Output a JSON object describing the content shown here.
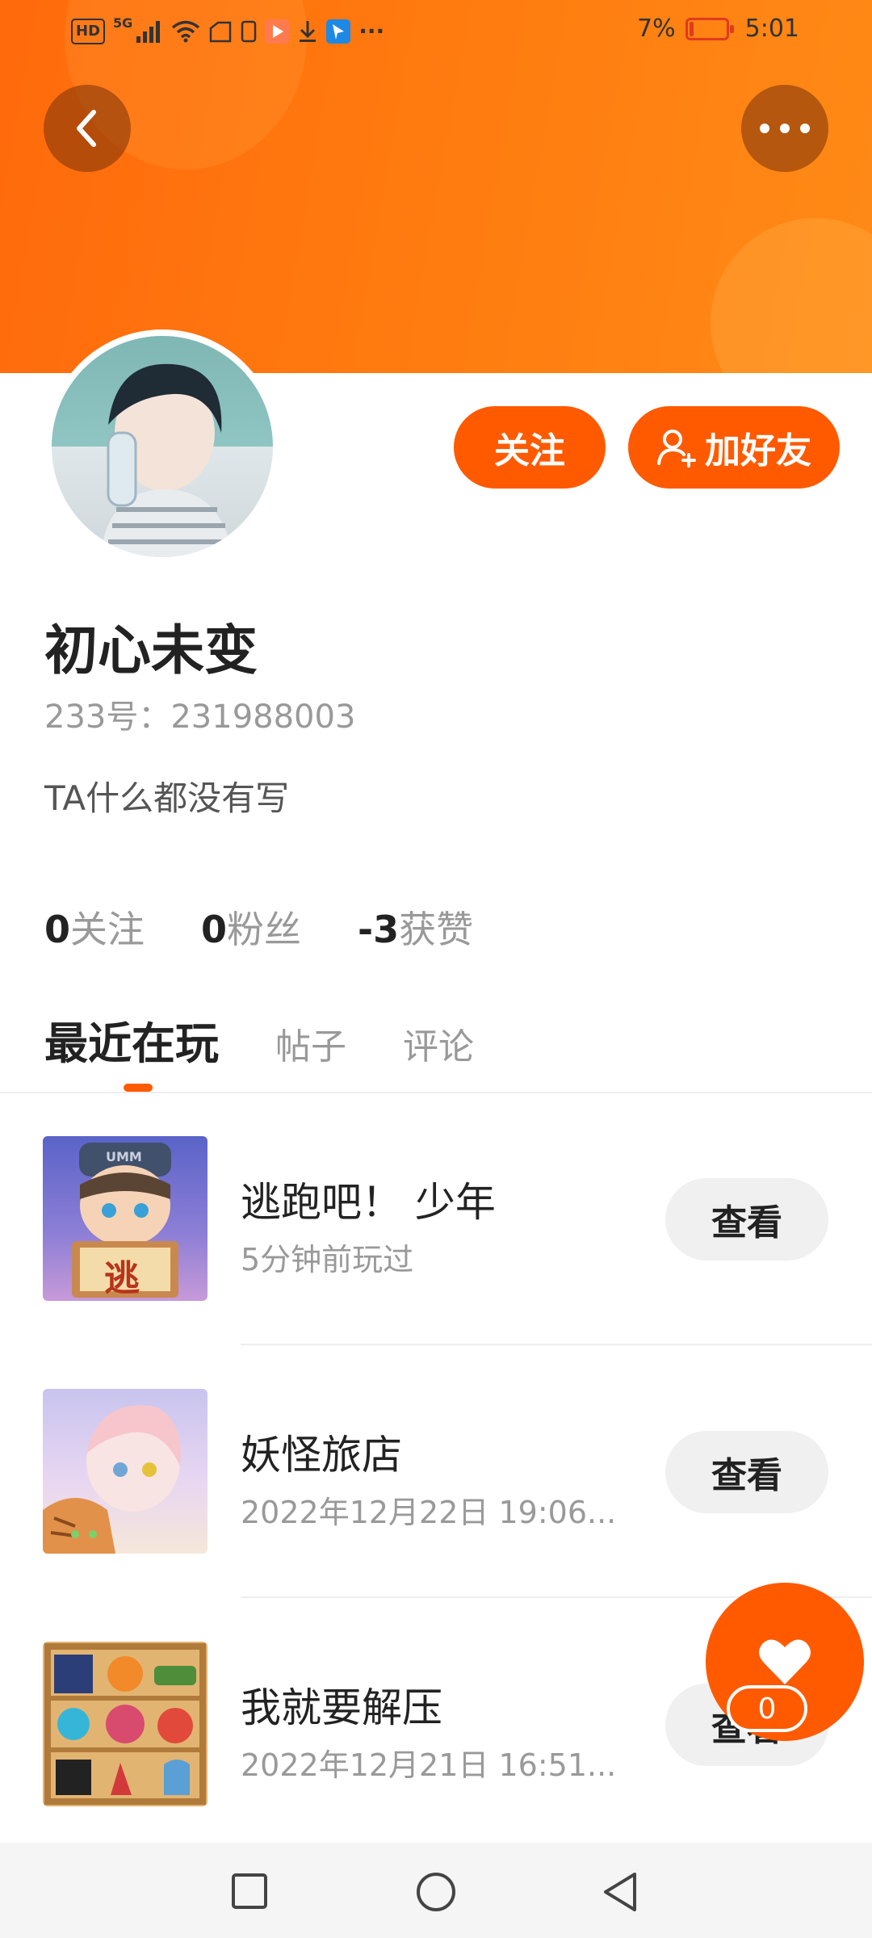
{
  "status_bar": {
    "hd": "HD",
    "network": "5G",
    "battery_percent": "7%",
    "time": "5:01",
    "more": "···"
  },
  "header": {
    "back_icon": "chevron-left-icon",
    "more_icon": "more-dots-icon"
  },
  "profile": {
    "follow_label": "关注",
    "add_friend_label": "加好友",
    "name": "初心未变",
    "uid": "233号：231988003",
    "bio": "TA什么都没有写"
  },
  "stats": {
    "following_count": "0",
    "following_label": "关注",
    "fans_count": "0",
    "fans_label": "粉丝",
    "likes_count": "-3",
    "likes_label": "获赞"
  },
  "tabs": [
    {
      "label": "最近在玩",
      "active": true
    },
    {
      "label": "帖子",
      "active": false
    },
    {
      "label": "评论",
      "active": false
    }
  ],
  "games": [
    {
      "title": "逃跑吧！ 少年",
      "subtitle": "5分钟前玩过",
      "button": "查看",
      "thumb_text": "逃",
      "cap_text": "UMM"
    },
    {
      "title": "妖怪旅店",
      "subtitle": "2022年12月22日 19:06...",
      "button": "查看"
    },
    {
      "title": "我就要解压",
      "subtitle": "2022年12月21日 16:51...",
      "button": "查看"
    }
  ],
  "fab": {
    "icon": "heart-icon",
    "count": "0"
  },
  "colors": {
    "accent": "#ff5a00",
    "banner": "#ff7a10"
  }
}
